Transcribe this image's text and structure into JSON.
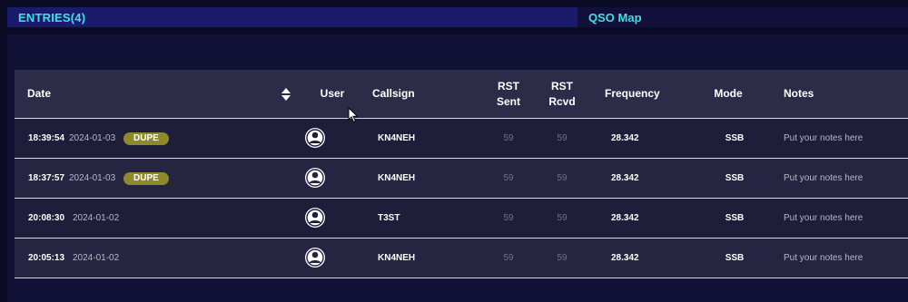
{
  "tabs": {
    "entries_label": "ENTRIES(4)",
    "map_label": "QSO Map"
  },
  "table": {
    "headers": {
      "date": "Date",
      "user": "User",
      "callsign": "Callsign",
      "rst_sent_1": "RST",
      "rst_sent_2": "Sent",
      "rst_rcvd_1": "RST",
      "rst_rcvd_2": "Rcvd",
      "frequency": "Frequency",
      "mode": "Mode",
      "notes": "Notes"
    },
    "rows": [
      {
        "time": "18:39:54",
        "date": "2024-01-03",
        "badge": "DUPE",
        "callsign": "KN4NEH",
        "rst_sent": "59",
        "rst_rcvd": "59",
        "frequency": "28.342",
        "mode": "SSB",
        "notes": "Put your notes here"
      },
      {
        "time": "18:37:57",
        "date": "2024-01-03",
        "badge": "DUPE",
        "callsign": "KN4NEH",
        "rst_sent": "59",
        "rst_rcvd": "59",
        "frequency": "28.342",
        "mode": "SSB",
        "notes": "Put your notes here"
      },
      {
        "time": "20:08:30",
        "date": "2024-01-02",
        "badge": "",
        "callsign": "T3ST",
        "rst_sent": "59",
        "rst_rcvd": "59",
        "frequency": "28.342",
        "mode": "SSB",
        "notes": "Put your notes here"
      },
      {
        "time": "20:05:13",
        "date": "2024-01-02",
        "badge": "",
        "callsign": "KN4NEH",
        "rst_sent": "59",
        "rst_rcvd": "59",
        "frequency": "28.342",
        "mode": "SSB",
        "notes": "Put your notes here"
      }
    ]
  },
  "icons": {
    "sort": "sort-icon",
    "user": "user-avatar-icon",
    "cursor": "mouse-cursor-icon"
  },
  "colors": {
    "accent": "#3fe0e6",
    "tab_active_bg": "#1b1b6e",
    "header_bg": "#2c2b48",
    "dupe_badge": "#8e8a2c"
  }
}
